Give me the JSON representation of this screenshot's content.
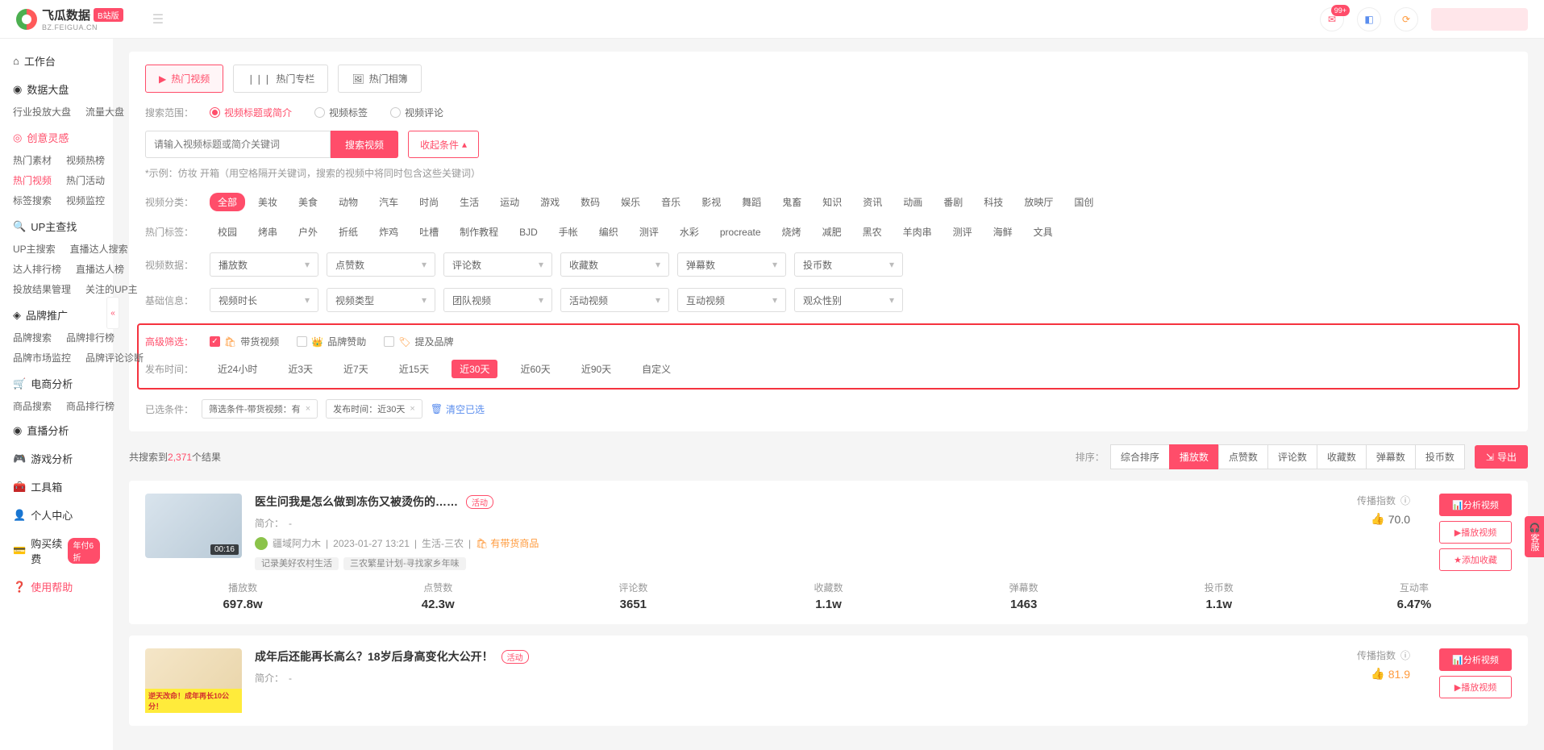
{
  "logo": {
    "text": "飞瓜数据",
    "sub": "BZ.FEIGUA.CN",
    "badge": "B站版"
  },
  "header": {
    "notif_badge": "99+"
  },
  "sidebar": {
    "workbench": "工作台",
    "data_board": "数据大盘",
    "data_board_items": [
      [
        "行业投放大盘",
        "流量大盘"
      ]
    ],
    "creative": "创意灵感",
    "creative_items": [
      [
        "热门素材",
        "视频热榜"
      ],
      [
        "热门视频",
        "热门活动"
      ],
      [
        "标签搜索",
        "视频监控"
      ]
    ],
    "up_search": "UP主查找",
    "up_items": [
      [
        "UP主搜索",
        "直播达人搜索"
      ],
      [
        "达人排行榜",
        "直播达人榜"
      ],
      [
        "投放结果管理",
        "关注的UP主"
      ]
    ],
    "brand": "品牌推广",
    "brand_items": [
      [
        "品牌搜索",
        "品牌排行榜"
      ],
      [
        "品牌市场监控",
        "品牌评论诊断"
      ]
    ],
    "ecom": "电商分析",
    "ecom_items": [
      [
        "商品搜索",
        "商品排行榜"
      ]
    ],
    "live": "直播分析",
    "game": "游戏分析",
    "tools": "工具箱",
    "user_center": "个人中心",
    "buy": "购买续费",
    "buy_badge": "年付6折",
    "help": "使用帮助"
  },
  "tabs": [
    "热门视频",
    "热门专栏",
    "热门相簿"
  ],
  "search": {
    "scope_label": "搜索范围：",
    "scopes": [
      "视频标题或简介",
      "视频标签",
      "视频评论"
    ],
    "placeholder": "请输入视频标题或简介关键词",
    "search_btn": "搜索视频",
    "collapse_btn": "收起条件",
    "hint": "*示例：仿妆 开箱（用空格隔开关键词，搜索的视频中将同时包含这些关键词）"
  },
  "filters": {
    "cat_label": "视频分类：",
    "categories": [
      "全部",
      "美妆",
      "美食",
      "动物",
      "汽车",
      "时尚",
      "生活",
      "运动",
      "游戏",
      "数码",
      "娱乐",
      "音乐",
      "影视",
      "舞蹈",
      "鬼畜",
      "知识",
      "资讯",
      "动画",
      "番剧",
      "科技",
      "放映厅",
      "国创"
    ],
    "tag_label": "热门标签：",
    "tags": [
      "校园",
      "烤串",
      "户外",
      "折纸",
      "炸鸡",
      "吐槽",
      "制作教程",
      "BJD",
      "手帐",
      "编织",
      "测评",
      "水彩",
      "procreate",
      "烧烤",
      "减肥",
      "黑农",
      "羊肉串",
      "测评",
      "海鲜",
      "文具"
    ],
    "data_label": "视频数据：",
    "data_selects": [
      "播放数",
      "点赞数",
      "评论数",
      "收藏数",
      "弹幕数",
      "投币数"
    ],
    "basic_label": "基础信息：",
    "basic_selects": [
      "视频时长",
      "视频类型",
      "团队视频",
      "活动视频",
      "互动视频",
      "观众性别"
    ],
    "adv_label": "高级筛选：",
    "adv_checks": [
      "带货视频",
      "品牌赞助",
      "提及品牌"
    ],
    "time_label": "发布时间：",
    "time_opts": [
      "近24小时",
      "近3天",
      "近7天",
      "近15天",
      "近30天",
      "近60天",
      "近90天",
      "自定义"
    ]
  },
  "selected": {
    "label": "已选条件：",
    "tags": [
      "筛选条件-带货视频：有",
      "发布时间：近30天"
    ],
    "clear": "清空已选"
  },
  "results": {
    "count_prefix": "共搜索到",
    "count": "2,371",
    "count_suffix": "个结果",
    "sort_label": "排序：",
    "sorts": [
      "综合排序",
      "播放数",
      "点赞数",
      "评论数",
      "收藏数",
      "弹幕数",
      "投币数"
    ],
    "export": "导出"
  },
  "videos": [
    {
      "title": "医生问我是怎么做到冻伤又被烫伤的……",
      "activity": "活动",
      "intro_label": "简介：",
      "intro": "-",
      "author": "疆域阿力木",
      "date": "2023-01-27 13:21",
      "cat": "生活-三农",
      "goods": "有带货商品",
      "tags": [
        "记录美好农村生活",
        "三农繁星计划-寻找家乡年味"
      ],
      "duration": "00:16",
      "prop_label": "传播指数",
      "prop_val": "70.0",
      "actions": [
        "分析视频",
        "播放视频",
        "添加收藏"
      ],
      "stats": [
        {
          "label": "播放数",
          "val": "697.8w"
        },
        {
          "label": "点赞数",
          "val": "42.3w"
        },
        {
          "label": "评论数",
          "val": "3651"
        },
        {
          "label": "收藏数",
          "val": "1.1w"
        },
        {
          "label": "弹幕数",
          "val": "1463"
        },
        {
          "label": "投币数",
          "val": "1.1w"
        },
        {
          "label": "互动率",
          "val": "6.47%"
        }
      ]
    },
    {
      "title": "成年后还能再长高么？18岁后身高变化大公开！",
      "activity": "活动",
      "intro_label": "简介：",
      "intro": "-",
      "prop_label": "传播指数",
      "prop_val": "81.9",
      "thumb_band": "逆天改命！成年再长10公分！",
      "actions": [
        "分析视频",
        "播放视频"
      ]
    }
  ],
  "float_service": "客服"
}
